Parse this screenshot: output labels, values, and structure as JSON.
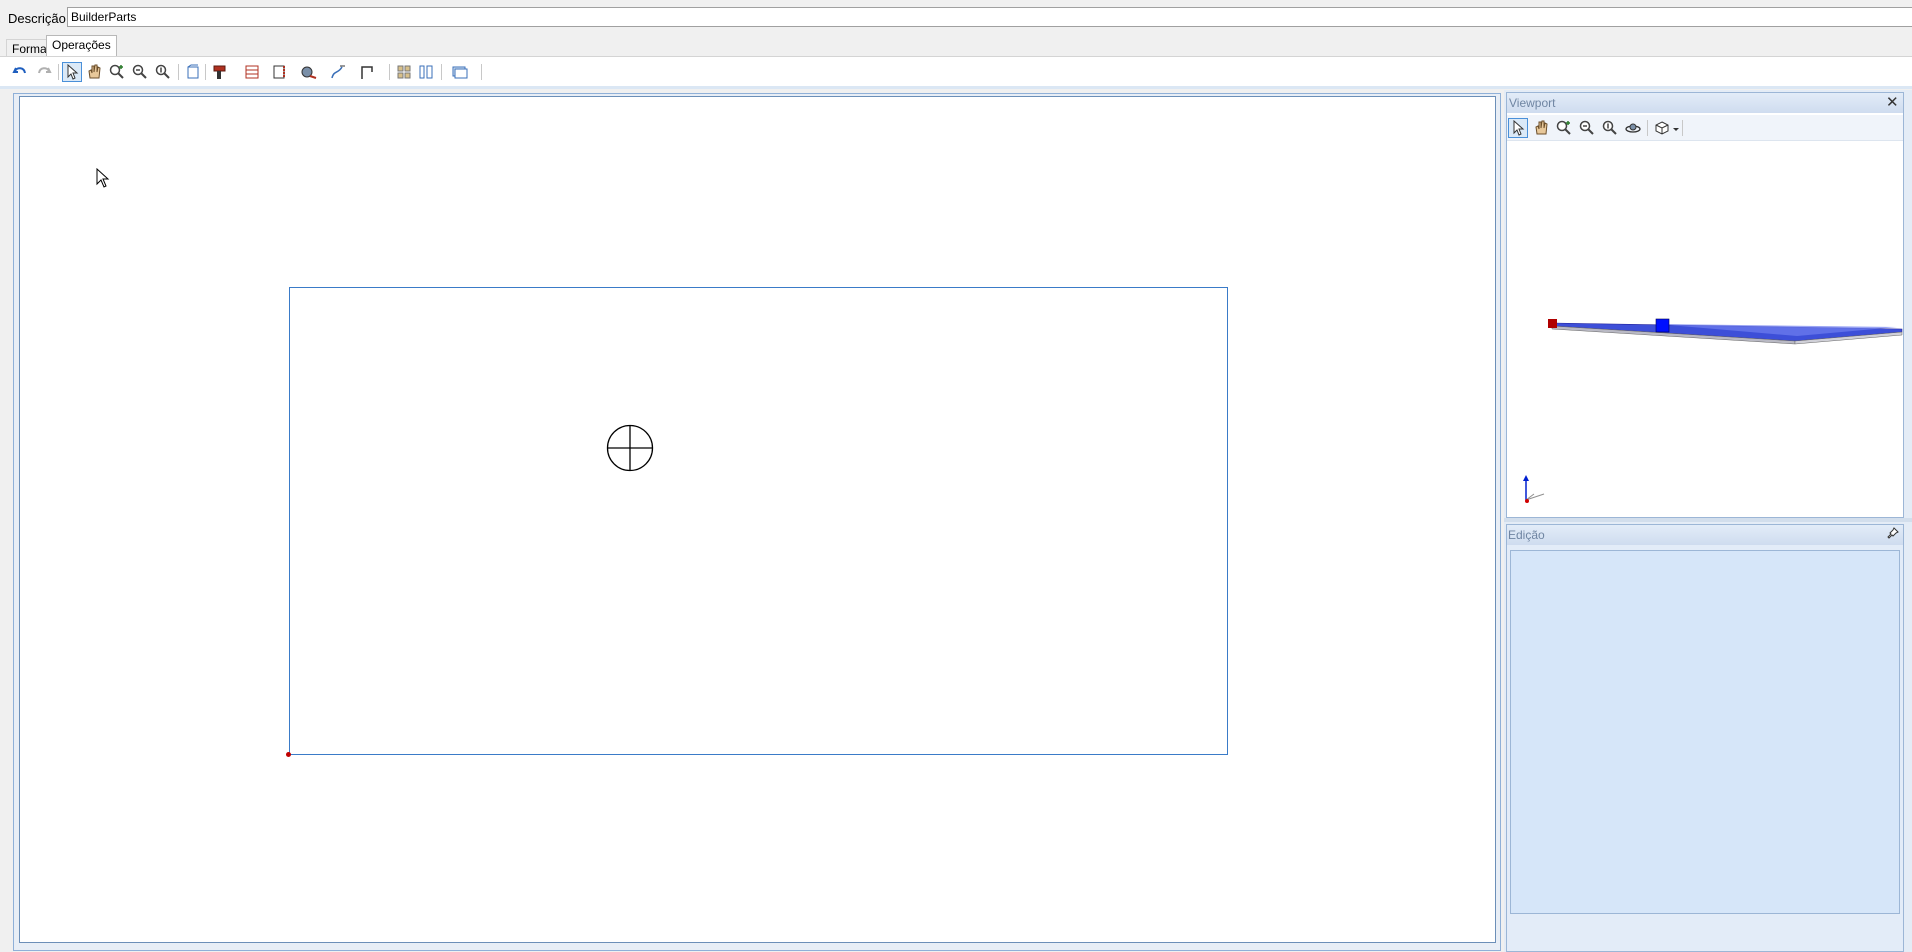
{
  "description": {
    "label": "Descrição",
    "value": "BuilderParts"
  },
  "tabs": [
    {
      "label": "Forma",
      "active": false
    },
    {
      "label": "Operações",
      "active": true
    }
  ],
  "main_toolbar": {
    "buttons": [
      "undo-icon",
      "redo-icon",
      "select-pointer-icon",
      "pan-hand-icon",
      "zoom-in-icon",
      "zoom-out-icon",
      "zoom-fit-icon",
      "new-sheet-icon",
      "drill-tool-icon",
      "pocket-tool-icon",
      "profile-tool-icon",
      "saw-tool-icon",
      "path-tool-icon",
      "frame-tool-icon",
      "grid-icon",
      "columns-icon",
      "view-options-icon"
    ]
  },
  "viewport_panel": {
    "title": "Viewport",
    "close_symbol": "✕",
    "toolbar_buttons": [
      "select-pointer-icon",
      "pan-hand-icon",
      "zoom-in-icon",
      "zoom-out-icon",
      "zoom-fit-icon",
      "orbit-icon",
      "view-cube-icon"
    ]
  },
  "edicao_panel": {
    "title": "Edição",
    "pin_symbol": "📌"
  },
  "colors": {
    "part_outline": "#3a7bc8",
    "origin_marker": "#c00000",
    "panel_header": "#cfdcef",
    "edit_body": "#d6e6f9"
  }
}
